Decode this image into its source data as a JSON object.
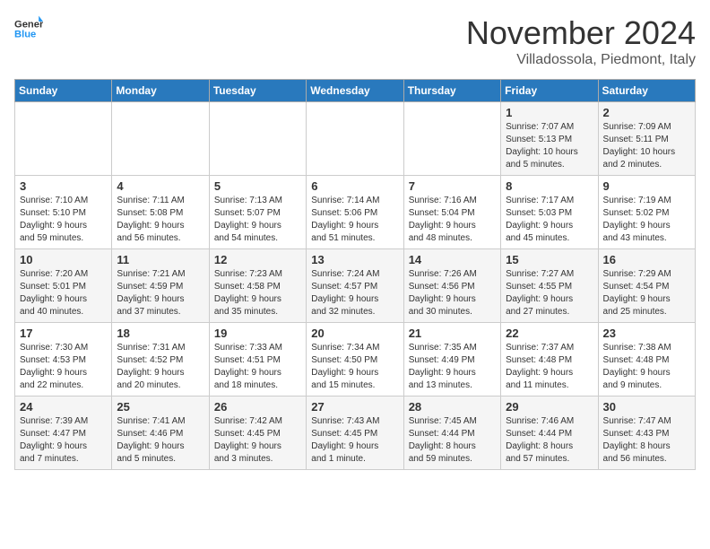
{
  "header": {
    "logo_line1": "General",
    "logo_line2": "Blue",
    "month": "November 2024",
    "location": "Villadossola, Piedmont, Italy"
  },
  "weekdays": [
    "Sunday",
    "Monday",
    "Tuesday",
    "Wednesday",
    "Thursday",
    "Friday",
    "Saturday"
  ],
  "weeks": [
    [
      {
        "day": "",
        "text": ""
      },
      {
        "day": "",
        "text": ""
      },
      {
        "day": "",
        "text": ""
      },
      {
        "day": "",
        "text": ""
      },
      {
        "day": "",
        "text": ""
      },
      {
        "day": "1",
        "text": "Sunrise: 7:07 AM\nSunset: 5:13 PM\nDaylight: 10 hours\nand 5 minutes."
      },
      {
        "day": "2",
        "text": "Sunrise: 7:09 AM\nSunset: 5:11 PM\nDaylight: 10 hours\nand 2 minutes."
      }
    ],
    [
      {
        "day": "3",
        "text": "Sunrise: 7:10 AM\nSunset: 5:10 PM\nDaylight: 9 hours\nand 59 minutes."
      },
      {
        "day": "4",
        "text": "Sunrise: 7:11 AM\nSunset: 5:08 PM\nDaylight: 9 hours\nand 56 minutes."
      },
      {
        "day": "5",
        "text": "Sunrise: 7:13 AM\nSunset: 5:07 PM\nDaylight: 9 hours\nand 54 minutes."
      },
      {
        "day": "6",
        "text": "Sunrise: 7:14 AM\nSunset: 5:06 PM\nDaylight: 9 hours\nand 51 minutes."
      },
      {
        "day": "7",
        "text": "Sunrise: 7:16 AM\nSunset: 5:04 PM\nDaylight: 9 hours\nand 48 minutes."
      },
      {
        "day": "8",
        "text": "Sunrise: 7:17 AM\nSunset: 5:03 PM\nDaylight: 9 hours\nand 45 minutes."
      },
      {
        "day": "9",
        "text": "Sunrise: 7:19 AM\nSunset: 5:02 PM\nDaylight: 9 hours\nand 43 minutes."
      }
    ],
    [
      {
        "day": "10",
        "text": "Sunrise: 7:20 AM\nSunset: 5:01 PM\nDaylight: 9 hours\nand 40 minutes."
      },
      {
        "day": "11",
        "text": "Sunrise: 7:21 AM\nSunset: 4:59 PM\nDaylight: 9 hours\nand 37 minutes."
      },
      {
        "day": "12",
        "text": "Sunrise: 7:23 AM\nSunset: 4:58 PM\nDaylight: 9 hours\nand 35 minutes."
      },
      {
        "day": "13",
        "text": "Sunrise: 7:24 AM\nSunset: 4:57 PM\nDaylight: 9 hours\nand 32 minutes."
      },
      {
        "day": "14",
        "text": "Sunrise: 7:26 AM\nSunset: 4:56 PM\nDaylight: 9 hours\nand 30 minutes."
      },
      {
        "day": "15",
        "text": "Sunrise: 7:27 AM\nSunset: 4:55 PM\nDaylight: 9 hours\nand 27 minutes."
      },
      {
        "day": "16",
        "text": "Sunrise: 7:29 AM\nSunset: 4:54 PM\nDaylight: 9 hours\nand 25 minutes."
      }
    ],
    [
      {
        "day": "17",
        "text": "Sunrise: 7:30 AM\nSunset: 4:53 PM\nDaylight: 9 hours\nand 22 minutes."
      },
      {
        "day": "18",
        "text": "Sunrise: 7:31 AM\nSunset: 4:52 PM\nDaylight: 9 hours\nand 20 minutes."
      },
      {
        "day": "19",
        "text": "Sunrise: 7:33 AM\nSunset: 4:51 PM\nDaylight: 9 hours\nand 18 minutes."
      },
      {
        "day": "20",
        "text": "Sunrise: 7:34 AM\nSunset: 4:50 PM\nDaylight: 9 hours\nand 15 minutes."
      },
      {
        "day": "21",
        "text": "Sunrise: 7:35 AM\nSunset: 4:49 PM\nDaylight: 9 hours\nand 13 minutes."
      },
      {
        "day": "22",
        "text": "Sunrise: 7:37 AM\nSunset: 4:48 PM\nDaylight: 9 hours\nand 11 minutes."
      },
      {
        "day": "23",
        "text": "Sunrise: 7:38 AM\nSunset: 4:48 PM\nDaylight: 9 hours\nand 9 minutes."
      }
    ],
    [
      {
        "day": "24",
        "text": "Sunrise: 7:39 AM\nSunset: 4:47 PM\nDaylight: 9 hours\nand 7 minutes."
      },
      {
        "day": "25",
        "text": "Sunrise: 7:41 AM\nSunset: 4:46 PM\nDaylight: 9 hours\nand 5 minutes."
      },
      {
        "day": "26",
        "text": "Sunrise: 7:42 AM\nSunset: 4:45 PM\nDaylight: 9 hours\nand 3 minutes."
      },
      {
        "day": "27",
        "text": "Sunrise: 7:43 AM\nSunset: 4:45 PM\nDaylight: 9 hours\nand 1 minute."
      },
      {
        "day": "28",
        "text": "Sunrise: 7:45 AM\nSunset: 4:44 PM\nDaylight: 8 hours\nand 59 minutes."
      },
      {
        "day": "29",
        "text": "Sunrise: 7:46 AM\nSunset: 4:44 PM\nDaylight: 8 hours\nand 57 minutes."
      },
      {
        "day": "30",
        "text": "Sunrise: 7:47 AM\nSunset: 4:43 PM\nDaylight: 8 hours\nand 56 minutes."
      }
    ]
  ]
}
